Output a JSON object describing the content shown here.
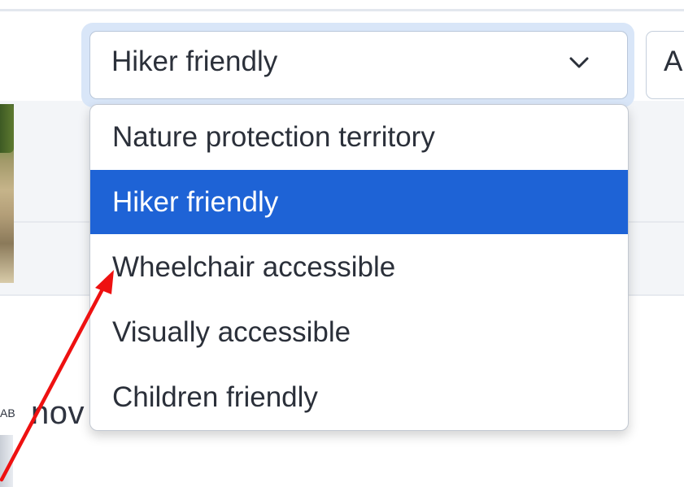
{
  "select": {
    "value": "Hiker friendly"
  },
  "next_control": {
    "label": "A"
  },
  "dropdown": {
    "options": [
      "Nature protection territory",
      "Hiker friendly",
      "Wheelchair accessible",
      "Visually accessible",
      "Children friendly"
    ],
    "selected_index": 1
  },
  "background": {
    "partial_text": "nov",
    "partial_small_text": "AB"
  },
  "colors": {
    "selected_option_bg": "#1e63d6",
    "focus_ring": "#d9e6f8",
    "annotation_arrow": "#ee1111"
  },
  "icons": {
    "select_chevron": "chevron-down-icon",
    "annotation": "red-arrow-annotation"
  }
}
